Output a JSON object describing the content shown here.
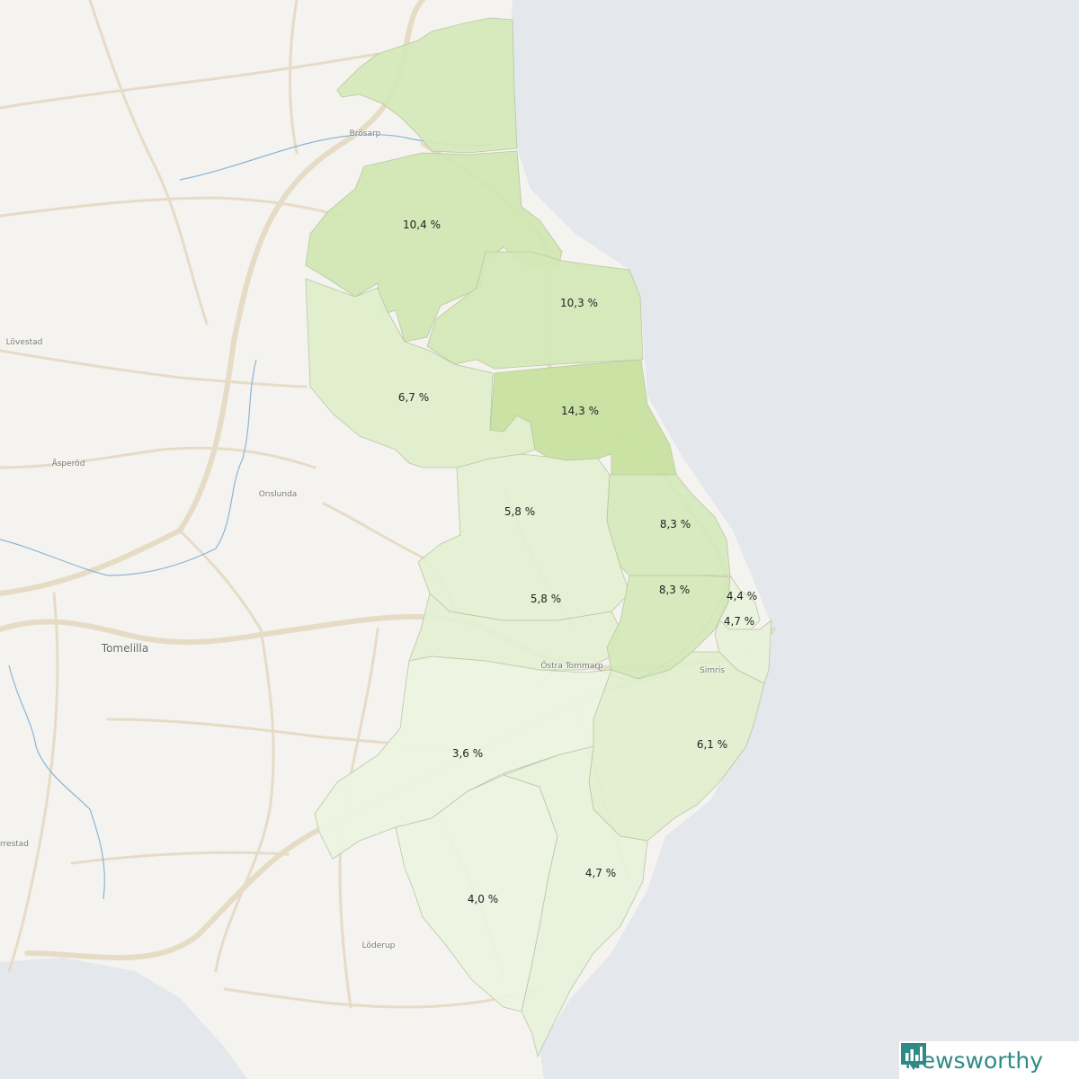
{
  "place_labels": [
    {
      "id": "brosarp",
      "text": "Brösarp"
    },
    {
      "id": "lovestad",
      "text": "Lövestad"
    },
    {
      "id": "asperod",
      "text": "Äsperöd"
    },
    {
      "id": "onslunda",
      "text": "Onslunda"
    },
    {
      "id": "tomelilla",
      "text": "Tomelilla"
    },
    {
      "id": "ostra-tommarp",
      "text": "Östra Tommarp"
    },
    {
      "id": "simris",
      "text": "Simris"
    },
    {
      "id": "rrestad",
      "text": "rrestad"
    },
    {
      "id": "loderup",
      "text": "Löderup"
    }
  ],
  "regions": [
    {
      "id": "north",
      "value": "",
      "color": "#d3e9b8"
    },
    {
      "id": "r1",
      "value": "10,4 %",
      "color": "#cfe6b2"
    },
    {
      "id": "r2",
      "value": "10,3 %",
      "color": "#d2e8b6"
    },
    {
      "id": "r3",
      "value": "6,7 %",
      "color": "#e0efcb"
    },
    {
      "id": "r4",
      "value": "14,3 %",
      "color": "#c5e29e"
    },
    {
      "id": "r5",
      "value": "5,8 %",
      "color": "#e3f0d2"
    },
    {
      "id": "r6",
      "value": "8,3 %",
      "color": "#d5e9bb"
    },
    {
      "id": "r7",
      "value": "5,8 %",
      "color": "#e3f0d2"
    },
    {
      "id": "r8",
      "value": "8,3 %",
      "color": "#d4e8b8"
    },
    {
      "id": "r9",
      "value": "4,4 %",
      "color": "#e8f3dc"
    },
    {
      "id": "r10",
      "value": "4,7 %",
      "color": "#e6f2d9"
    },
    {
      "id": "r11",
      "value": "3,6 %",
      "color": "#ecf5e1"
    },
    {
      "id": "r12",
      "value": "6,1 %",
      "color": "#e1efcd"
    },
    {
      "id": "r13",
      "value": "4,0 %",
      "color": "#ebf4df"
    },
    {
      "id": "r14",
      "value": "4,7 %",
      "color": "#e7f2da"
    }
  ],
  "colors": {
    "land": "#f4f3ef",
    "sea": "#e4e7eb",
    "road": "#e6dcc6",
    "water_line": "#8ab6d8",
    "brand": "#2f8a86"
  },
  "logo": {
    "text": "Newsworthy",
    "icon": "newsworthy-logo-icon"
  }
}
